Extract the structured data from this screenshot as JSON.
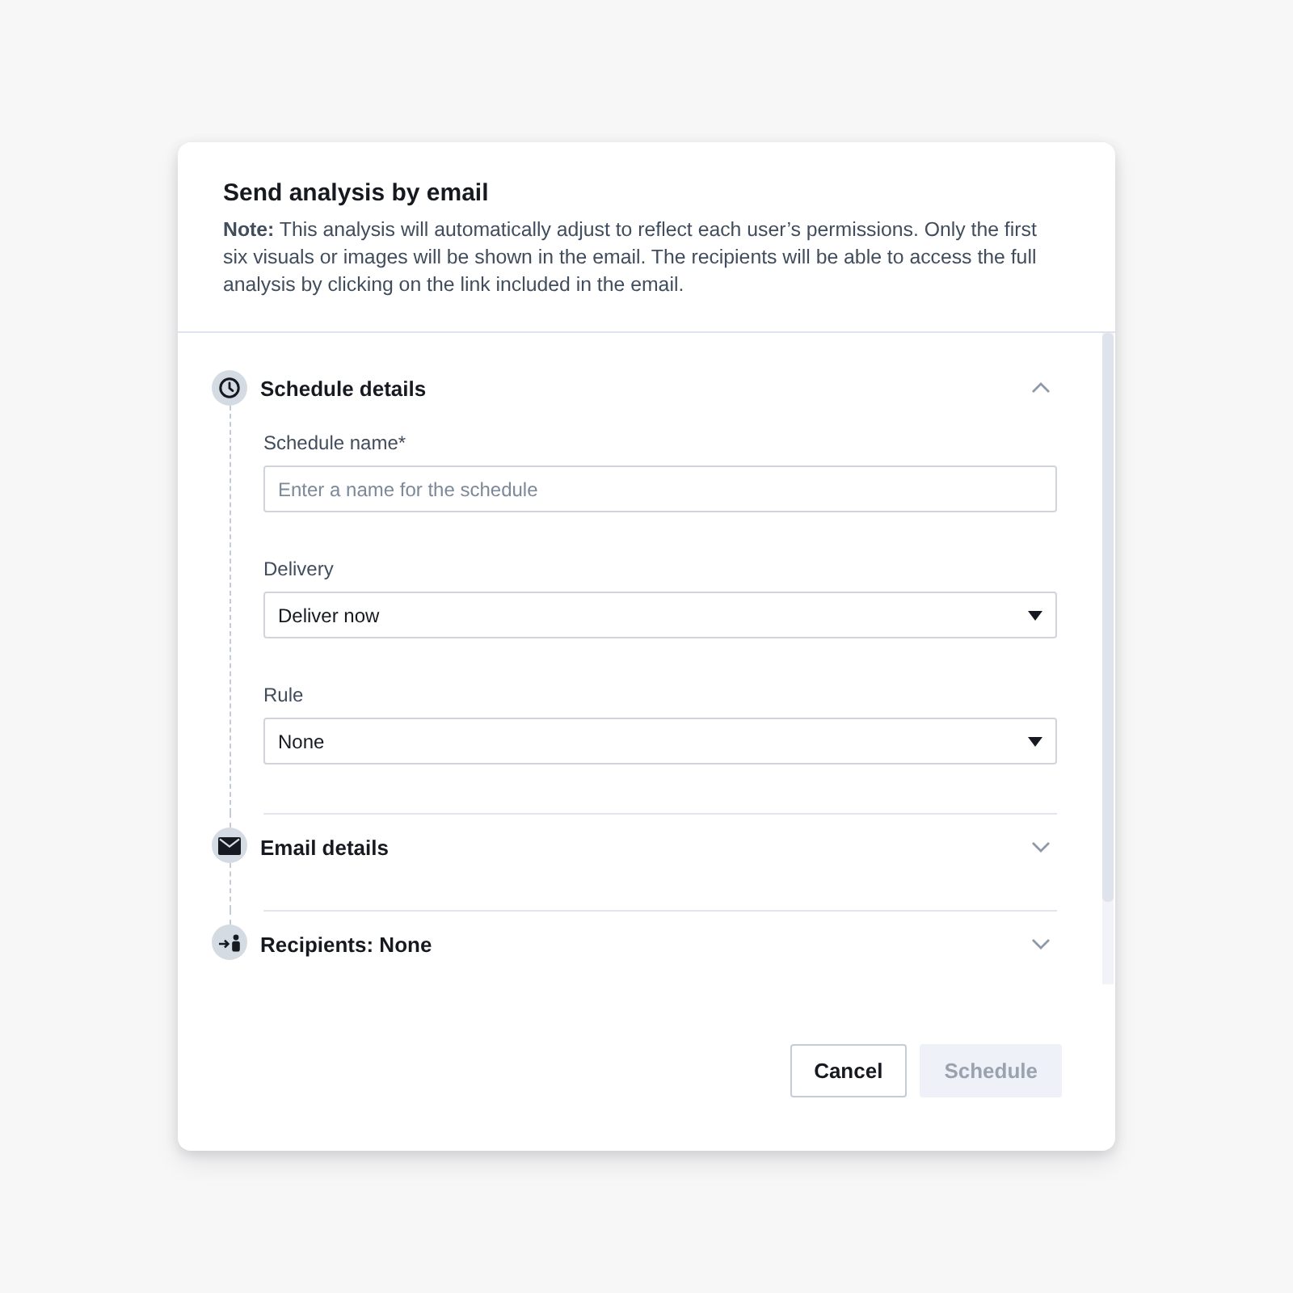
{
  "dialog": {
    "title": "Send analysis by email",
    "note": "**Note:** This analysis will automatically adjust to reflect each user’s permissions. Only the first six visuals or images will be shown in the email. The recipients will be able to access the full analysis by clicking on the link included in the email.",
    "sections": [
      {
        "kind": "clock",
        "title": "Schedule details",
        "expanded": true,
        "fields": [
          {
            "kind": "text",
            "label": "Schedule name*",
            "placeholder": "Enter a name for the schedule"
          },
          {
            "kind": "select",
            "label": "Delivery",
            "value": "Deliver now"
          },
          {
            "kind": "select",
            "label": "Rule",
            "value": "None"
          }
        ]
      },
      {
        "kind": "mail",
        "title": "Email details",
        "expanded": false
      },
      {
        "kind": "recipients",
        "title": "Recipients: None",
        "expanded": false
      }
    ],
    "buttons": [
      {
        "label": "Cancel",
        "disabled": false
      },
      {
        "label": "Schedule",
        "disabled": true
      }
    ]
  }
}
